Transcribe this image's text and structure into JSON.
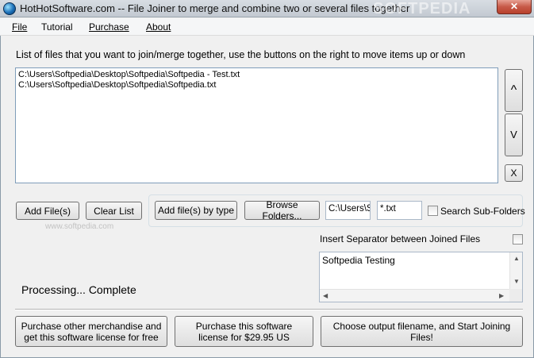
{
  "window": {
    "title": "HotHotSoftware.com -- File Joiner to merge and combine two or several files together",
    "close_label": "✕",
    "watermark_title": "SOFTPEDIA"
  },
  "menu": {
    "items": [
      {
        "label": "File"
      },
      {
        "label": "Tutorial"
      },
      {
        "label": "Purchase"
      },
      {
        "label": "About"
      }
    ]
  },
  "main": {
    "instructions": "List of files that you want to join/merge together, use the buttons on the right to move items up or down",
    "files": [
      "C:\\Users\\Softpedia\\Desktop\\Softpedia\\Softpedia - Test.txt",
      "C:\\Users\\Softpedia\\Desktop\\Softpedia\\Softpedia.txt"
    ],
    "move_up_label": "^",
    "move_down_label": "V",
    "remove_label": "X"
  },
  "buttons": {
    "add_files": "Add File(s)",
    "clear_list": "Clear List",
    "add_by_type": "Add file(s) by type",
    "browse_folders": "Browse Folders...",
    "purchase_merch": "Purchase other merchandise and get this software license for free",
    "purchase_license": "Purchase this software license for $29.95 US",
    "start_join": "Choose output filename, and Start Joining Files!"
  },
  "folder_search": {
    "folder_value": "C:\\Users\\Softpedia",
    "pattern_value": "*.txt",
    "subfolders_label": "Search Sub-Folders",
    "subfolders_checked": false
  },
  "separator": {
    "label": "Insert Separator between Joined Files",
    "checked": false,
    "text": "Softpedia Testing"
  },
  "status": {
    "text": "Processing... Complete"
  },
  "watermark": "www.softpedia.com"
}
